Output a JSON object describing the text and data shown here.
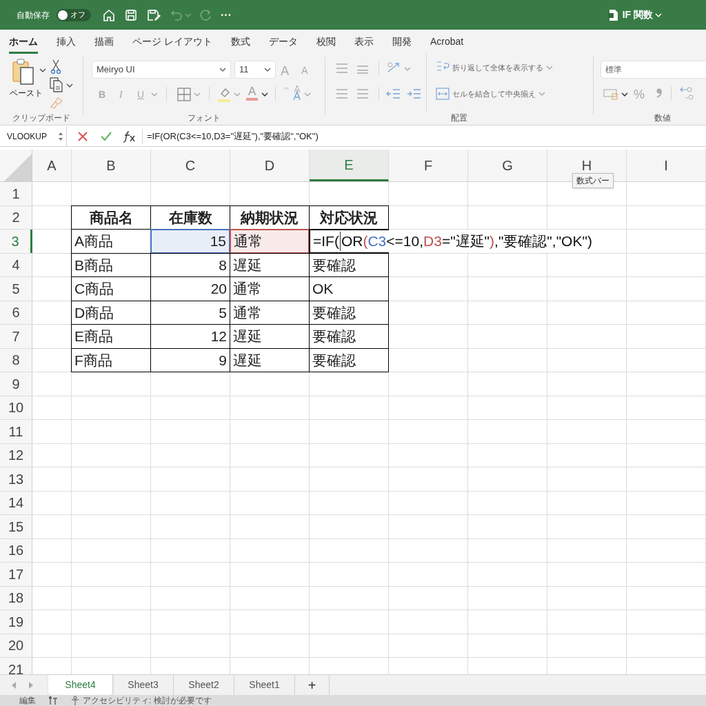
{
  "title_bar": {
    "autosave_label": "自動保存",
    "autosave_toggle": {
      "label": "オフ",
      "on": false
    },
    "more": "···",
    "document_title": "IF 関数"
  },
  "ribbon_tabs": [
    {
      "label": "ホーム",
      "selected": true
    },
    {
      "label": "挿入",
      "selected": false
    },
    {
      "label": "描画",
      "selected": false
    },
    {
      "label": "ページ レイアウト",
      "selected": false
    },
    {
      "label": "数式",
      "selected": false
    },
    {
      "label": "データ",
      "selected": false
    },
    {
      "label": "校閲",
      "selected": false
    },
    {
      "label": "表示",
      "selected": false
    },
    {
      "label": "開発",
      "selected": false
    },
    {
      "label": "Acrobat",
      "selected": false
    }
  ],
  "ribbon": {
    "clipboard": {
      "paste_label": "ペースト",
      "group_label": "クリップボード"
    },
    "font": {
      "font_name": "Meiryo UI",
      "font_size": "11",
      "grow": "A",
      "shrink": "A",
      "bold": "B",
      "italic": "I",
      "underline": "U",
      "font_color": "A",
      "group_label": "フォント"
    },
    "alignment": {
      "wrap_text": "折り返して全体を表示する",
      "merge_center": "セルを結合して中央揃え",
      "group_label": "配置"
    },
    "number": {
      "format": "標準",
      "percent": "%",
      "group_label": "数値"
    }
  },
  "formula_bar": {
    "name_box": "VLOOKUP",
    "formula": "=IF(OR(C3<=10,D3=\"遅延\"),\"要確認\",\"OK\")"
  },
  "tooltip": "数式バー",
  "columns": [
    {
      "label": "A",
      "selected": false
    },
    {
      "label": "B",
      "selected": false
    },
    {
      "label": "C",
      "selected": false
    },
    {
      "label": "D",
      "selected": false
    },
    {
      "label": "E",
      "selected": true
    },
    {
      "label": "F",
      "selected": false
    },
    {
      "label": "G",
      "selected": false
    },
    {
      "label": "H",
      "selected": false
    },
    {
      "label": "I",
      "selected": false
    }
  ],
  "rows": [
    {
      "label": "1",
      "selected": false
    },
    {
      "label": "2",
      "selected": false
    },
    {
      "label": "3",
      "selected": true
    },
    {
      "label": "4",
      "selected": false
    },
    {
      "label": "5",
      "selected": false
    },
    {
      "label": "6",
      "selected": false
    },
    {
      "label": "7",
      "selected": false
    },
    {
      "label": "8",
      "selected": false
    },
    {
      "label": "9",
      "selected": false
    },
    {
      "label": "10",
      "selected": false
    },
    {
      "label": "11",
      "selected": false
    },
    {
      "label": "12",
      "selected": false
    },
    {
      "label": "13",
      "selected": false
    },
    {
      "label": "14",
      "selected": false
    },
    {
      "label": "15",
      "selected": false
    },
    {
      "label": "16",
      "selected": false
    },
    {
      "label": "17",
      "selected": false
    },
    {
      "label": "18",
      "selected": false
    },
    {
      "label": "19",
      "selected": false
    },
    {
      "label": "20",
      "selected": false
    },
    {
      "label": "21",
      "selected": false
    }
  ],
  "table": {
    "header": [
      "商品名",
      "在庫数",
      "納期状況",
      "対応状況"
    ],
    "rows": [
      [
        {
          "kind": "text",
          "text": "A商品"
        },
        {
          "kind": "number",
          "text": "15",
          "color": "#4472c4"
        },
        {
          "kind": "text",
          "text": "通常",
          "color": "#c0504d"
        },
        {
          "kind": "formula",
          "segments": [
            {
              "kind": "plain",
              "text": "=IF("
            },
            {
              "kind": "caret"
            },
            {
              "kind": "plain",
              "text": "OR"
            },
            {
              "kind": "ref2",
              "text": "("
            },
            {
              "kind": "ref1",
              "text": "C3"
            },
            {
              "kind": "plain",
              "text": "<=10,"
            },
            {
              "kind": "ref2",
              "text": "D3"
            },
            {
              "kind": "plain",
              "text": "=\"遅延\""
            },
            {
              "kind": "ref2",
              "text": ")"
            },
            {
              "kind": "plain",
              "text": ",\"要確認\",\"OK\")"
            }
          ]
        }
      ],
      [
        {
          "kind": "text",
          "text": "B商品"
        },
        {
          "kind": "number",
          "text": "8"
        },
        {
          "kind": "text",
          "text": "遅延"
        },
        {
          "kind": "text",
          "text": "要確認"
        }
      ],
      [
        {
          "kind": "text",
          "text": "C商品"
        },
        {
          "kind": "number",
          "text": "20"
        },
        {
          "kind": "text",
          "text": "通常"
        },
        {
          "kind": "text",
          "text": "OK"
        }
      ],
      [
        {
          "kind": "text",
          "text": "D商品"
        },
        {
          "kind": "number",
          "text": "5"
        },
        {
          "kind": "text",
          "text": "通常"
        },
        {
          "kind": "text",
          "text": "要確認"
        }
      ],
      [
        {
          "kind": "text",
          "text": "E商品"
        },
        {
          "kind": "number",
          "text": "12"
        },
        {
          "kind": "text",
          "text": "遅延"
        },
        {
          "kind": "text",
          "text": "要確認"
        }
      ],
      [
        {
          "kind": "text",
          "text": "F商品"
        },
        {
          "kind": "number",
          "text": "9"
        },
        {
          "kind": "text",
          "text": "遅延"
        },
        {
          "kind": "text",
          "text": "要確認"
        }
      ]
    ]
  },
  "sheet_tabs": [
    {
      "label": "Sheet4",
      "selected": true
    },
    {
      "label": "Sheet3",
      "selected": false
    },
    {
      "label": "Sheet2",
      "selected": false
    },
    {
      "label": "Sheet1",
      "selected": false
    }
  ],
  "add_sheet": "+",
  "status_bar": {
    "mode": "編集",
    "accessibility": "アクセシビリティ: 検討が必要です"
  }
}
